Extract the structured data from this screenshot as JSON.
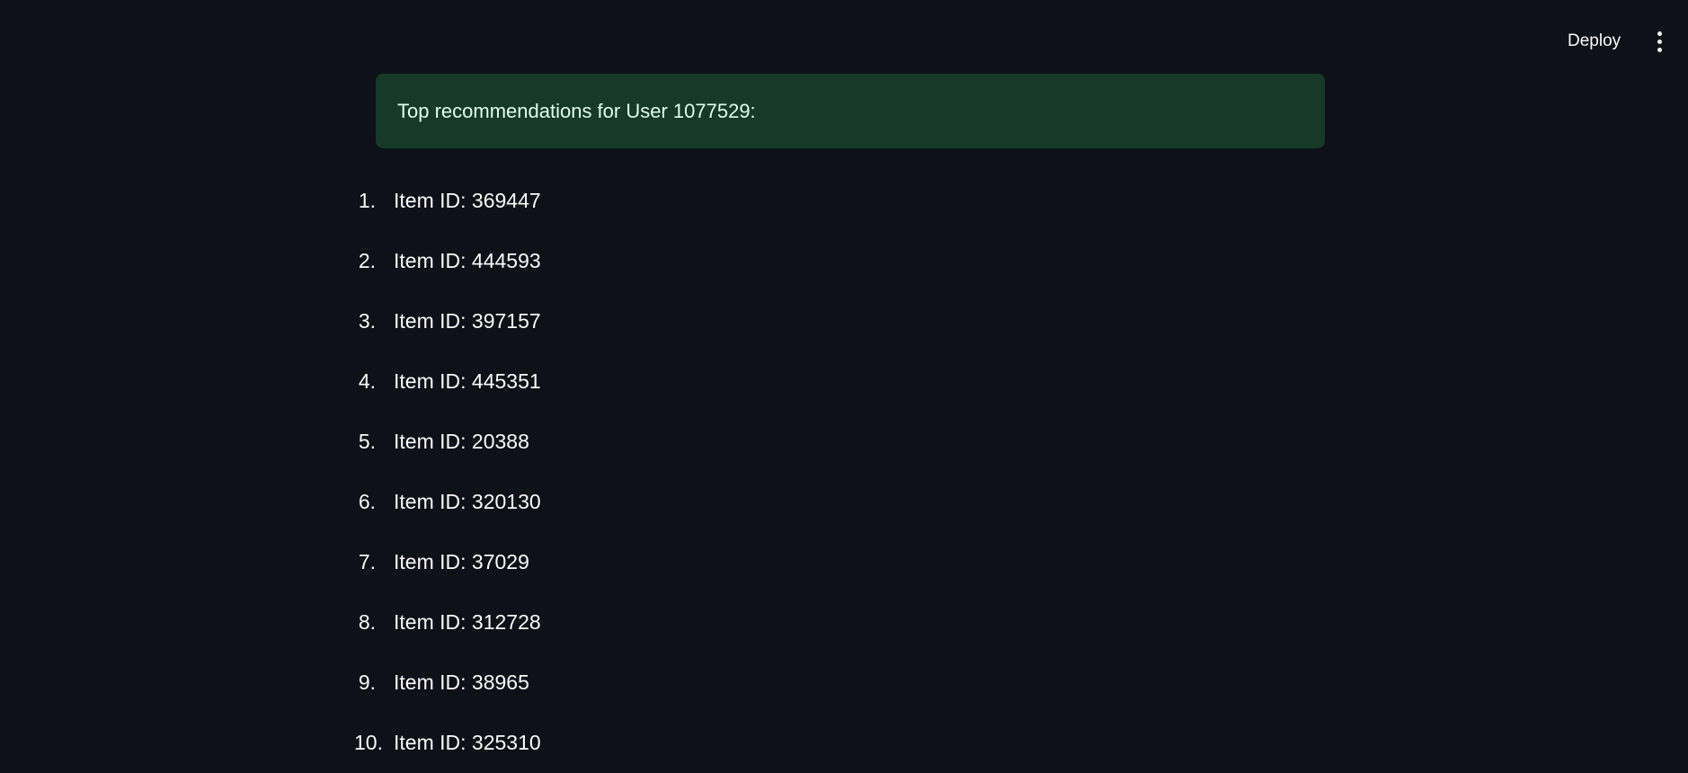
{
  "header": {
    "deploy_label": "Deploy",
    "menu_icon": "vertical-ellipsis-icon"
  },
  "alert": {
    "text": "Top recommendations for User 1077529:",
    "color": "#173928"
  },
  "recommendations": [
    {
      "num": "1.",
      "label": "Item ID: 369447"
    },
    {
      "num": "2.",
      "label": "Item ID: 444593"
    },
    {
      "num": "3.",
      "label": "Item ID: 397157"
    },
    {
      "num": "4.",
      "label": "Item ID: 445351"
    },
    {
      "num": "5.",
      "label": "Item ID: 20388"
    },
    {
      "num": "6.",
      "label": "Item ID: 320130"
    },
    {
      "num": "7.",
      "label": "Item ID: 37029"
    },
    {
      "num": "8.",
      "label": "Item ID: 312728"
    },
    {
      "num": "9.",
      "label": "Item ID: 38965"
    },
    {
      "num": "10.",
      "label": "Item ID: 325310"
    }
  ]
}
